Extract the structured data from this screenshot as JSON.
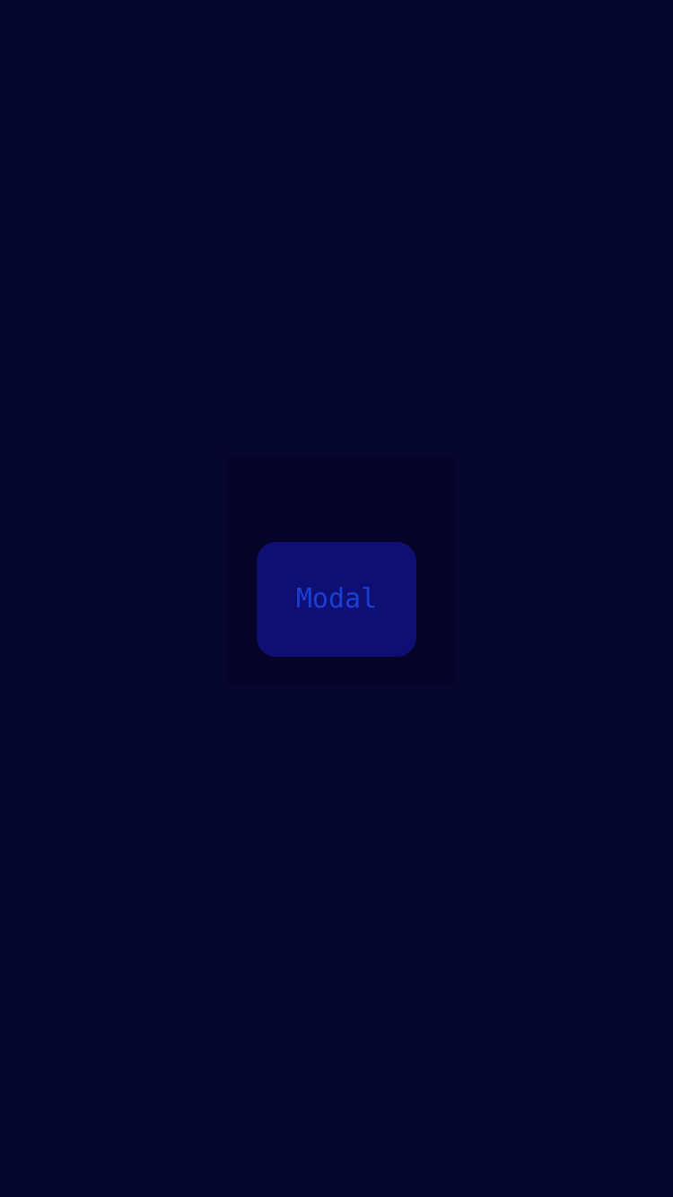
{
  "modal": {
    "button_label": "Modal"
  },
  "colors": {
    "background": "#06052d",
    "overlay": "#050428",
    "button_bg": "#0f0f73",
    "button_text": "#1a3fd2"
  }
}
